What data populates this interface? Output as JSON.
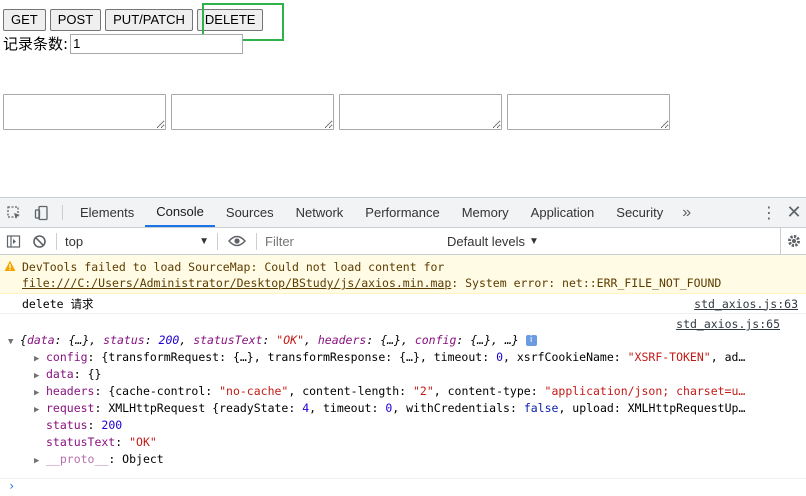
{
  "page": {
    "buttons": [
      "GET",
      "POST",
      "PUT/PATCH",
      "DELETE"
    ],
    "count_label": "记录条数:",
    "count_value": "1"
  },
  "devtools": {
    "tabs": [
      "Elements",
      "Console",
      "Sources",
      "Network",
      "Performance",
      "Memory",
      "Application",
      "Security"
    ],
    "active_tab": "Console",
    "more": "»",
    "context": "top",
    "filter_placeholder": "Filter",
    "levels": "Default levels"
  },
  "console": {
    "warning": {
      "prefix": "DevTools failed to load SourceMap: Could not load content for ",
      "link": "file:///C:/Users/Administrator/Desktop/BStudy/js/axios.min.map",
      "suffix": ": System error: net::ERR_FILE_NOT_FOUND"
    },
    "log1": {
      "text": "delete 请求",
      "source": "std_axios.js:63"
    },
    "log2": {
      "source": "std_axios.js:65"
    },
    "summary": {
      "open": "{",
      "data_key": "data",
      "data_val": "{…}",
      "status_key": "status",
      "status_val": "200",
      "statusText_key": "statusText",
      "statusText_val": "\"OK\"",
      "headers_key": "headers",
      "headers_val": "{…}",
      "config_key": "config",
      "config_val": "{…}",
      "close": "…}"
    },
    "rows": {
      "config": {
        "key": "config",
        "pre": "{transformRequest: {…}, transformResponse: {…}, timeout: ",
        "timeout": "0",
        "mid": ", xsrfCookieName: ",
        "xsrf": "\"XSRF-TOKEN\"",
        "end": ", ad…"
      },
      "data": {
        "key": "data",
        "val": "{}"
      },
      "headers": {
        "key": "headers",
        "pre": "{cache-control: ",
        "cc": "\"no-cache\"",
        "mid": ", content-length: ",
        "cl": "\"2\"",
        "mid2": ", content-type: ",
        "ct": "\"application/json; charset=u…"
      },
      "request": {
        "key": "request",
        "pre": "XMLHttpRequest {readyState: ",
        "rs": "4",
        "mid": ", timeout: ",
        "to": "0",
        "mid2": ", withCredentials: ",
        "wc": "false",
        "end": ", upload: XMLHttpRequestUp…"
      },
      "status": {
        "key": "status",
        "val": "200"
      },
      "statusText": {
        "key": "statusText",
        "val": "\"OK\""
      },
      "proto": {
        "key": "__proto__",
        "val": "Object"
      }
    }
  }
}
